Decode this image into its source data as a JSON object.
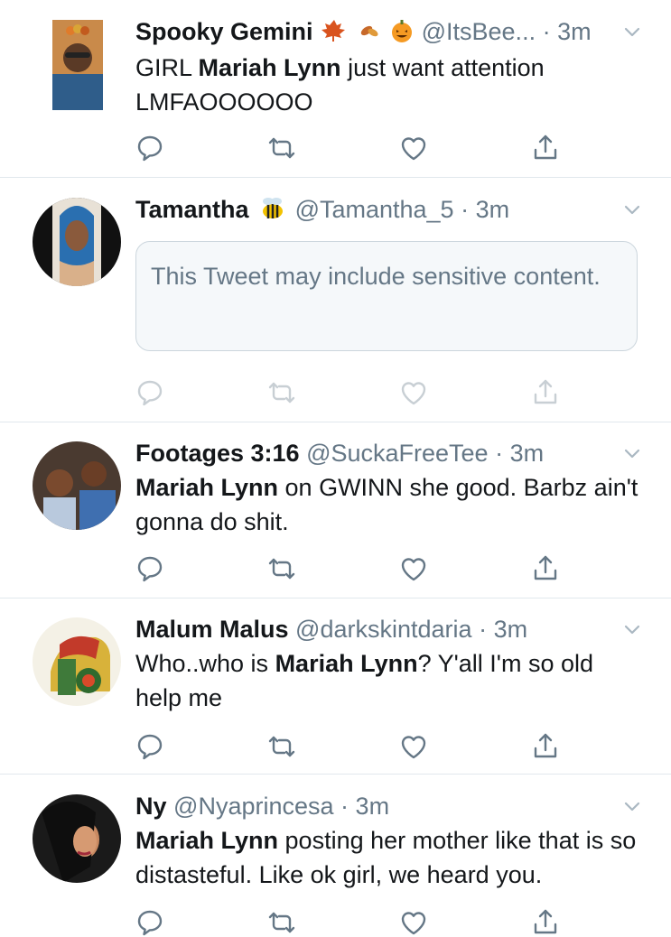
{
  "tweets": [
    {
      "name": "Spooky Gemini",
      "emojis": [
        "maple-leaf",
        "fallen-leaf",
        "jack-o-lantern"
      ],
      "handle": "@ItsBee...",
      "separator": "·",
      "time": "3m",
      "body": [
        {
          "text": "GIRL "
        },
        {
          "text": "Mariah Lynn",
          "bold": true
        },
        {
          "text": " just want attention LMFAOOOOOO"
        }
      ]
    },
    {
      "name": "Tamantha",
      "emojis": [
        "bee"
      ],
      "handle": "@Tamantha_5",
      "separator": "·",
      "time": "3m",
      "sensitive_notice": "This Tweet may include sensitive content."
    },
    {
      "name": "Footages 3:16",
      "handle": "@SuckaFreeTee",
      "separator": "·",
      "time": "3m",
      "body": [
        {
          "text": "Mariah Lynn",
          "bold": true
        },
        {
          "text": " on GWINN she good. Barbz ain't gonna do shit."
        }
      ]
    },
    {
      "name": "Malum Malus",
      "handle": "@darkskintdaria",
      "separator": "·",
      "time": "3m",
      "body": [
        {
          "text": "Who..who is "
        },
        {
          "text": "Mariah Lynn",
          "bold": true
        },
        {
          "text": "? Y'all I'm so old help me"
        }
      ]
    },
    {
      "name": "Ny",
      "handle": "@Nyaprincesa",
      "separator": "·",
      "time": "3m",
      "body": [
        {
          "text": "Mariah Lynn",
          "bold": true
        },
        {
          "text": " posting her mother like that is so distasteful. Like ok girl, we heard you."
        }
      ]
    }
  ],
  "icons": {
    "reply": "reply-icon",
    "retweet": "retweet-icon",
    "like": "like-icon",
    "share": "share-icon",
    "more": "chevron-down-icon"
  },
  "colors": {
    "text": "#14171a",
    "secondary": "#657786",
    "divider": "#e1e8ed",
    "sensitive_bg": "#f5f8fa"
  }
}
